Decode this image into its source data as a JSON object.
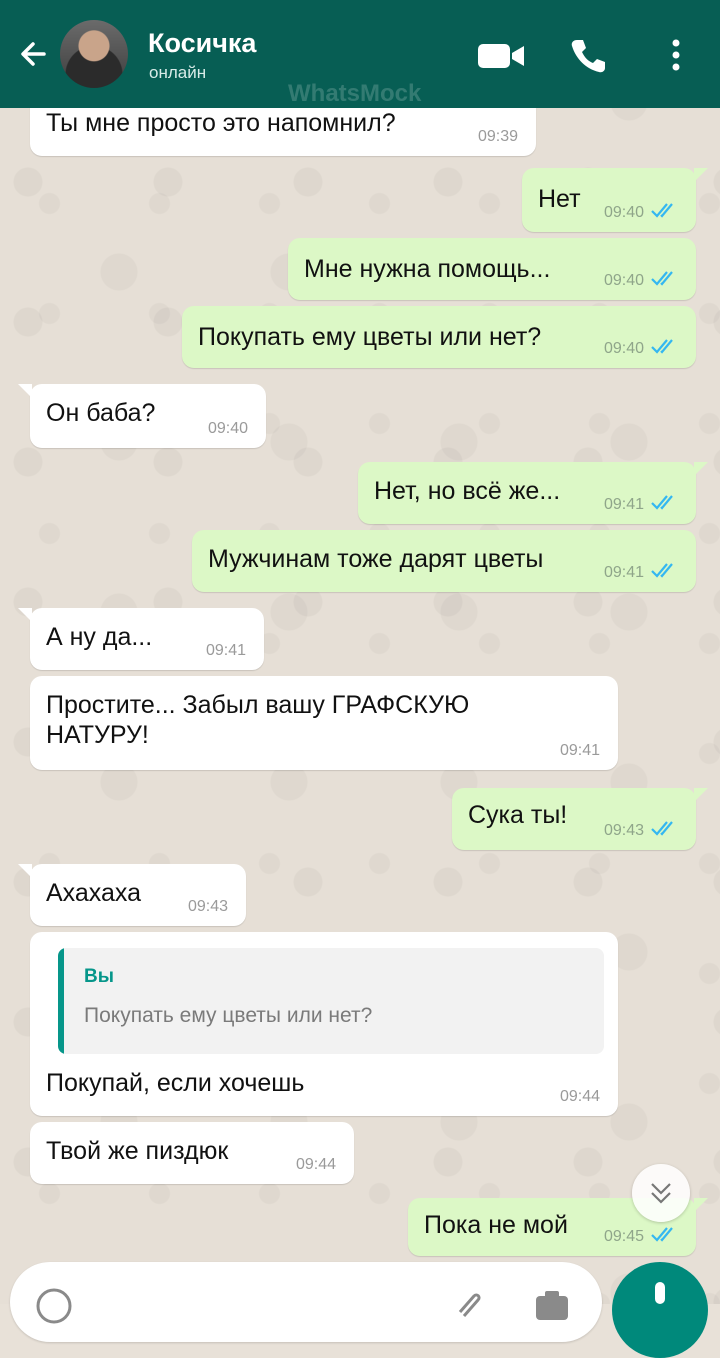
{
  "header": {
    "contact_name": "Косичка",
    "status": "онлайн",
    "watermark": "WhatsMock",
    "icons": [
      "back-arrow-icon",
      "avatar",
      "video-call-icon",
      "phone-icon",
      "more-vert-icon"
    ]
  },
  "messages": [
    {
      "dir": "in",
      "text": "Ты мне просто это напомнил?",
      "time": "09:39"
    },
    {
      "dir": "out",
      "text": "Нет",
      "time": "09:40",
      "read": true
    },
    {
      "dir": "out",
      "text": "Мне нужна помощь...",
      "time": "09:40",
      "read": true
    },
    {
      "dir": "out",
      "text": "Покупать ему цветы или нет?",
      "time": "09:40",
      "read": true
    },
    {
      "dir": "in",
      "text": "Он баба?",
      "time": "09:40"
    },
    {
      "dir": "out",
      "text": "Нет, но всё же...",
      "time": "09:41",
      "read": true
    },
    {
      "dir": "out",
      "text": "Мужчинам тоже дарят цветы",
      "time": "09:41",
      "read": true
    },
    {
      "dir": "in",
      "text": "А ну да...",
      "time": "09:41"
    },
    {
      "dir": "in",
      "text_line1": "Простите... Забыл вашу ГРАФСКУЮ",
      "text_line2": "НАТУРУ!",
      "time": "09:41"
    },
    {
      "dir": "out",
      "text": "Сука ты!",
      "time": "09:43",
      "read": true
    },
    {
      "dir": "in",
      "text": "Ахахаха",
      "time": "09:43"
    },
    {
      "dir": "in",
      "quote_author": "Вы",
      "quote_text": "Покупать ему цветы или нет?",
      "text": "Покупай, если хочешь",
      "time": "09:44"
    },
    {
      "dir": "in",
      "text": "Твой же пиздюк",
      "time": "09:44"
    },
    {
      "dir": "out",
      "text": "Пока не мой",
      "time": "09:45",
      "read": true
    }
  ],
  "colors": {
    "header": "#075e54",
    "outgoing_bubble": "#dcf8c6",
    "incoming_bubble": "#ffffff",
    "read_ticks": "#34b7f1",
    "accent": "#00897b"
  }
}
